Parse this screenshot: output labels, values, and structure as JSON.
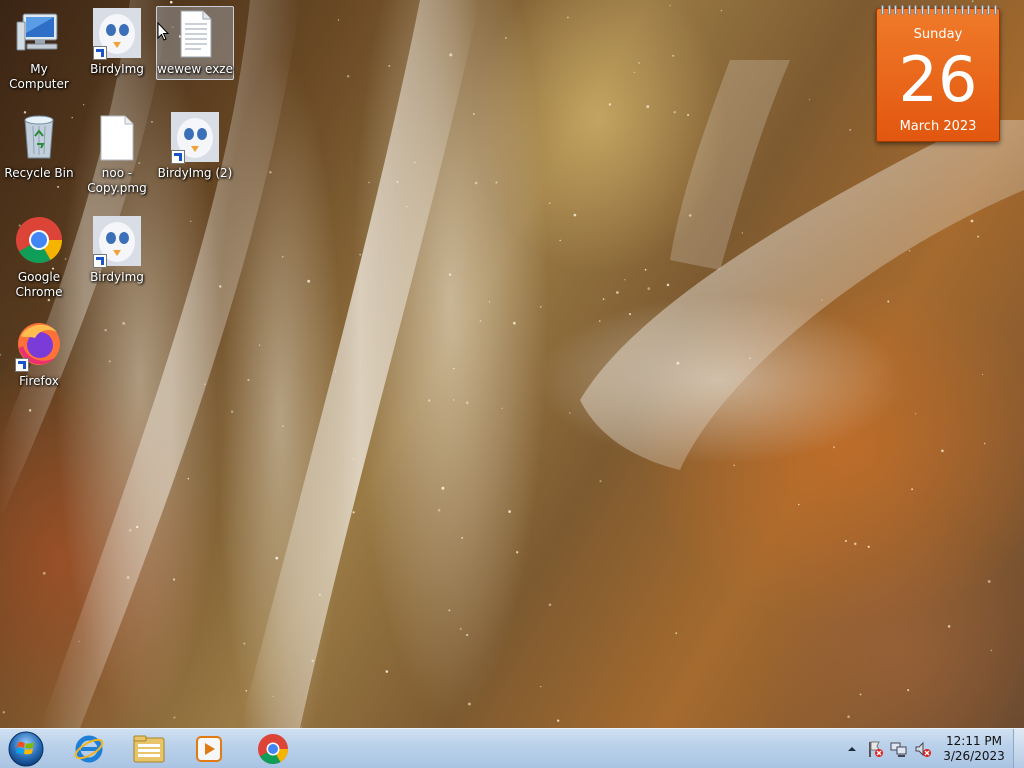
{
  "desktop": {
    "icons": [
      {
        "label": "My Computer"
      },
      {
        "label": "BirdyImg"
      },
      {
        "label": "wewew exze"
      },
      {
        "label": "Recycle Bin"
      },
      {
        "label": "noo - Copy.pmg"
      },
      {
        "label": "BirdyImg (2)"
      },
      {
        "label": "Google Chrome"
      },
      {
        "label": "BirdyImg"
      },
      {
        "label": "Firefox"
      }
    ]
  },
  "calendar": {
    "day": "Sunday",
    "date": "26",
    "month_year": "March 2023",
    "color": "#e8661c"
  },
  "taskbar": {
    "pinned": [
      "windows-start-orb",
      "internet-explorer-icon",
      "windows-explorer-icon",
      "media-player-icon",
      "google-chrome-icon"
    ],
    "tray_icons": [
      "show-hidden-icons-arrow",
      "action-center-flag-icon",
      "network-icon",
      "volume-muted-icon"
    ],
    "clock": {
      "time": "12:11 PM",
      "date": "3/26/2023"
    }
  }
}
